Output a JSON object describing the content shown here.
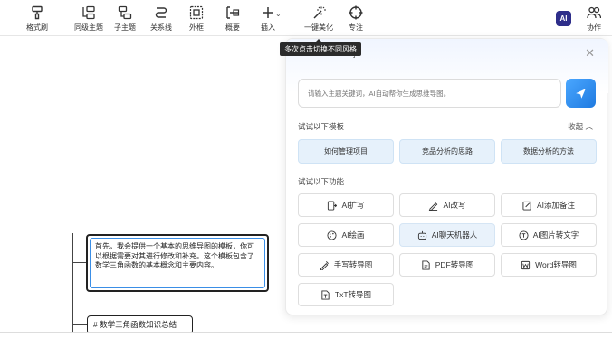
{
  "toolbar": {
    "items": [
      {
        "label": "格式刷",
        "icon": "format-brush-icon"
      },
      {
        "label": "同级主题",
        "icon": "sibling-topic-icon"
      },
      {
        "label": "子主题",
        "icon": "child-topic-icon"
      },
      {
        "label": "关系线",
        "icon": "relation-line-icon"
      },
      {
        "label": "外框",
        "icon": "outer-frame-icon"
      },
      {
        "label": "概要",
        "icon": "summary-icon"
      },
      {
        "label": "插入",
        "icon": "plus-icon"
      },
      {
        "label": "一键美化",
        "icon": "magic-wand-icon"
      },
      {
        "label": "专注",
        "icon": "focus-icon"
      },
      {
        "label": "协作",
        "icon": "collaboration-icon"
      }
    ],
    "ai_badge": "AI"
  },
  "tooltip": "多次点击切换不同风格",
  "panel": {
    "title_fragment": "]",
    "input_placeholder": "请输入主题关键词，AI自动帮你生成思维导图。",
    "templates_title": "试试以下模板",
    "collapse_label": "收起",
    "templates": [
      "如何管理项目",
      "竞品分析的思路",
      "数据分析的方法"
    ],
    "functions_title": "试试以下功能",
    "functions": [
      {
        "label": "AI扩写",
        "icon": "expand-doc-icon"
      },
      {
        "label": "AI改写",
        "icon": "pen-icon"
      },
      {
        "label": "AI添加备注",
        "icon": "note-edit-icon"
      },
      {
        "label": "AI绘画",
        "icon": "palette-icon"
      },
      {
        "label": "AI聊天机器人",
        "icon": "robot-icon"
      },
      {
        "label": "AI图片转文字",
        "icon": "image-text-icon"
      },
      {
        "label": "手写转导图",
        "icon": "handwriting-icon"
      },
      {
        "label": "PDF转导图",
        "icon": "pdf-icon"
      },
      {
        "label": "Word转导图",
        "icon": "word-icon"
      },
      {
        "label": "TxT转导图",
        "icon": "txt-icon"
      }
    ]
  },
  "canvas": {
    "main_node_text": "首先，我会提供一个基本的思维导图的模板，你可以根据需要对其进行修改和补充。这个模板包含了数学三角函数的基本概念和主要内容。",
    "sub_node_text": "# 数学三角函数知识总结"
  },
  "colors": {
    "accent": "#1f7ae0",
    "template_bg": "#e6f1fb",
    "selection_border": "#3a8ee6"
  }
}
